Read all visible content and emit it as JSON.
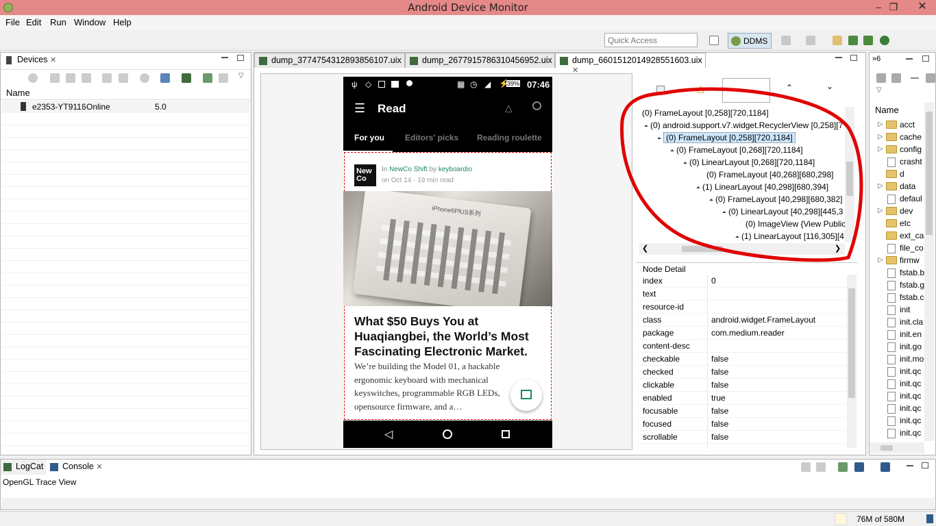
{
  "window": {
    "title": "Android Device Monitor"
  },
  "menu": [
    "File",
    "Edit",
    "Run",
    "Window",
    "Help"
  ],
  "toolbar": {
    "quick_access_placeholder": "Quick Access",
    "perspective": "DDMS"
  },
  "devices": {
    "tab": "Devices",
    "header_name": "Name",
    "rows": [
      {
        "name": "e2353-YT9116",
        "status": "Online",
        "version": "5.0"
      }
    ]
  },
  "editor_tabs": [
    {
      "label": "dump_3774754312893856107.uix",
      "active": false
    },
    {
      "label": "dump_2677915786310456952.uix",
      "active": false
    },
    {
      "label": "dump_6601512014928551603.uix",
      "active": true
    }
  ],
  "phone": {
    "status_bar": {
      "battery": "39%",
      "time": "07:46"
    },
    "app_title": "Read",
    "tabs": [
      "For you",
      "Editors' picks",
      "Reading roulette"
    ],
    "post": {
      "logo": "New Co",
      "in_label": "In",
      "publication": "NewCo Shift",
      "by_label": "by",
      "author": "keyboardio",
      "meta": "on Oct 14 · 19 min read",
      "image_caption": "iPhone6PlUS系列",
      "headline": "What $50 Buys You at Huaqiangbei, the World’s Most Fascinating Electronic Market.",
      "excerpt": "We’re building the Model 01, a hackable ergonomic keyboard with mechanical keyswitches, programmable RGB LEDs, opensource firmware, and a…"
    }
  },
  "hierarchy": {
    "nodes": [
      {
        "text": "(0) FrameLayout [0,258][720,1184]",
        "expander": false
      },
      {
        "text": "(0) android.support.v7.widget.RecyclerView [0,258][7",
        "expander": true
      },
      {
        "text": "(0) FrameLayout [0,258][720,1184]",
        "expander": true,
        "selected": true
      },
      {
        "text": "(0) FrameLayout [0,268][720,1184]",
        "expander": true
      },
      {
        "text": "(0) LinearLayout [0,268][720,1184]",
        "expander": true
      },
      {
        "text": "(0) FrameLayout [40,268][680,298]",
        "expander": false
      },
      {
        "text": "(1) LinearLayout [40,298][680,394]",
        "expander": true
      },
      {
        "text": "(0) FrameLayout [40,298][680,382]",
        "expander": true
      },
      {
        "text": "(0) LinearLayout [40,298][445,3",
        "expander": true
      },
      {
        "text": "(0) ImageView {View Public",
        "expander": false
      },
      {
        "text": "(1) LinearLayout [116,305][4",
        "expander": true
      }
    ]
  },
  "node_detail": {
    "title": "Node Detail",
    "rows": [
      {
        "key": "index",
        "value": "0"
      },
      {
        "key": "text",
        "value": ""
      },
      {
        "key": "resource-id",
        "value": ""
      },
      {
        "key": "class",
        "value": "android.widget.FrameLayout"
      },
      {
        "key": "package",
        "value": "com.medium.reader"
      },
      {
        "key": "content-desc",
        "value": ""
      },
      {
        "key": "checkable",
        "value": "false"
      },
      {
        "key": "checked",
        "value": "false"
      },
      {
        "key": "clickable",
        "value": "false"
      },
      {
        "key": "enabled",
        "value": "true"
      },
      {
        "key": "focusable",
        "value": "false"
      },
      {
        "key": "focused",
        "value": "false"
      },
      {
        "key": "scrollable",
        "value": "false"
      }
    ]
  },
  "file_explorer": {
    "tab_label": "6",
    "header_name": "Name",
    "items": [
      {
        "name": "acct",
        "type": "folder",
        "expandable": true
      },
      {
        "name": "cache",
        "type": "folder",
        "expandable": true
      },
      {
        "name": "config",
        "type": "folder",
        "expandable": true
      },
      {
        "name": "crasht",
        "type": "file",
        "expandable": false
      },
      {
        "name": "d",
        "type": "folder",
        "expandable": false
      },
      {
        "name": "data",
        "type": "folder",
        "expandable": true
      },
      {
        "name": "defaul",
        "type": "file",
        "expandable": false
      },
      {
        "name": "dev",
        "type": "folder",
        "expandable": true
      },
      {
        "name": "etc",
        "type": "folder",
        "expandable": false
      },
      {
        "name": "ext_ca",
        "type": "folder",
        "expandable": false
      },
      {
        "name": "file_co",
        "type": "file",
        "expandable": false
      },
      {
        "name": "firmw",
        "type": "folder",
        "expandable": true
      },
      {
        "name": "fstab.b",
        "type": "file",
        "expandable": false
      },
      {
        "name": "fstab.g",
        "type": "file",
        "expandable": false
      },
      {
        "name": "fstab.c",
        "type": "file",
        "expandable": false
      },
      {
        "name": "init",
        "type": "file",
        "expandable": false
      },
      {
        "name": "init.cla",
        "type": "file",
        "expandable": false
      },
      {
        "name": "init.en",
        "type": "file",
        "expandable": false
      },
      {
        "name": "init.go",
        "type": "file",
        "expandable": false
      },
      {
        "name": "init.mo",
        "type": "file",
        "expandable": false
      },
      {
        "name": "init.qc",
        "type": "file",
        "expandable": false
      },
      {
        "name": "init.qc",
        "type": "file",
        "expandable": false
      },
      {
        "name": "init.qc",
        "type": "file",
        "expandable": false
      },
      {
        "name": "init.qc",
        "type": "file",
        "expandable": false
      },
      {
        "name": "init.qc",
        "type": "file",
        "expandable": false
      },
      {
        "name": "init.qc",
        "type": "file",
        "expandable": false
      }
    ]
  },
  "bottom": {
    "tabs": [
      {
        "label": "LogCat",
        "active": false
      },
      {
        "label": "Console",
        "active": true
      }
    ],
    "console_title": "OpenGL Trace View",
    "memory": "76M of 580M"
  },
  "colors": {
    "annotation": "#e00000",
    "medium_green": "#1a8b5a",
    "titlebar": "#e58988",
    "selection": "#cde8ff"
  }
}
